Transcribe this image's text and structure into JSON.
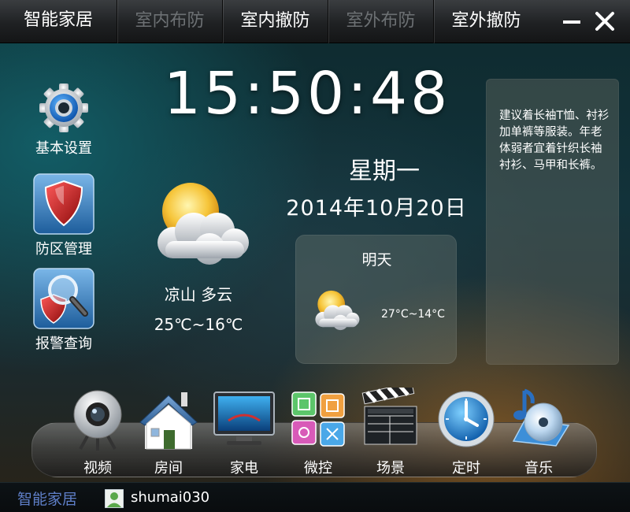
{
  "app": {
    "title": "智能家居"
  },
  "tabs": [
    {
      "label": "室内布防",
      "enabled": false
    },
    {
      "label": "室内撤防",
      "enabled": true
    },
    {
      "label": "室外布防",
      "enabled": false
    },
    {
      "label": "室外撤防",
      "enabled": true
    }
  ],
  "window_controls": {
    "minimize_icon": "minimize-icon",
    "close_icon": "close-icon"
  },
  "sidebar": {
    "items": [
      {
        "label": "基本设置",
        "icon": "gear-icon"
      },
      {
        "label": "防区管理",
        "icon": "shield-icon"
      },
      {
        "label": "报警查询",
        "icon": "magnifier-shield-icon"
      }
    ]
  },
  "clock": {
    "time": "15:50:48",
    "weekday": "星期一",
    "date": "2014年10月20日"
  },
  "weather": {
    "today": {
      "city_condition": "凉山 多云",
      "temp": "25℃~16℃",
      "icon": "partly-cloudy-icon"
    },
    "tomorrow": {
      "title": "明天",
      "temp": "27°C~14°C",
      "icon": "partly-cloudy-icon"
    }
  },
  "advice": {
    "text": "建议着长袖T恤、衬衫加单裤等服装。年老体弱者宜着针织长袖衬衫、马甲和长裤。"
  },
  "dock": {
    "items": [
      {
        "label": "视频",
        "icon": "webcam-icon"
      },
      {
        "label": "房间",
        "icon": "house-icon"
      },
      {
        "label": "家电",
        "icon": "tv-icon"
      },
      {
        "label": "微控",
        "icon": "tiles-icon"
      },
      {
        "label": "场景",
        "icon": "clapperboard-icon"
      },
      {
        "label": "定时",
        "icon": "clock-icon"
      },
      {
        "label": "音乐",
        "icon": "music-cd-icon"
      }
    ]
  },
  "status": {
    "brand": "智能家居",
    "username": "shumai030",
    "avatar_icon": "user-avatar-icon"
  },
  "colors": {
    "title_bar": "#1f2123",
    "disabled_tab": "#6c7073",
    "brand_text": "#5f7fc8"
  }
}
